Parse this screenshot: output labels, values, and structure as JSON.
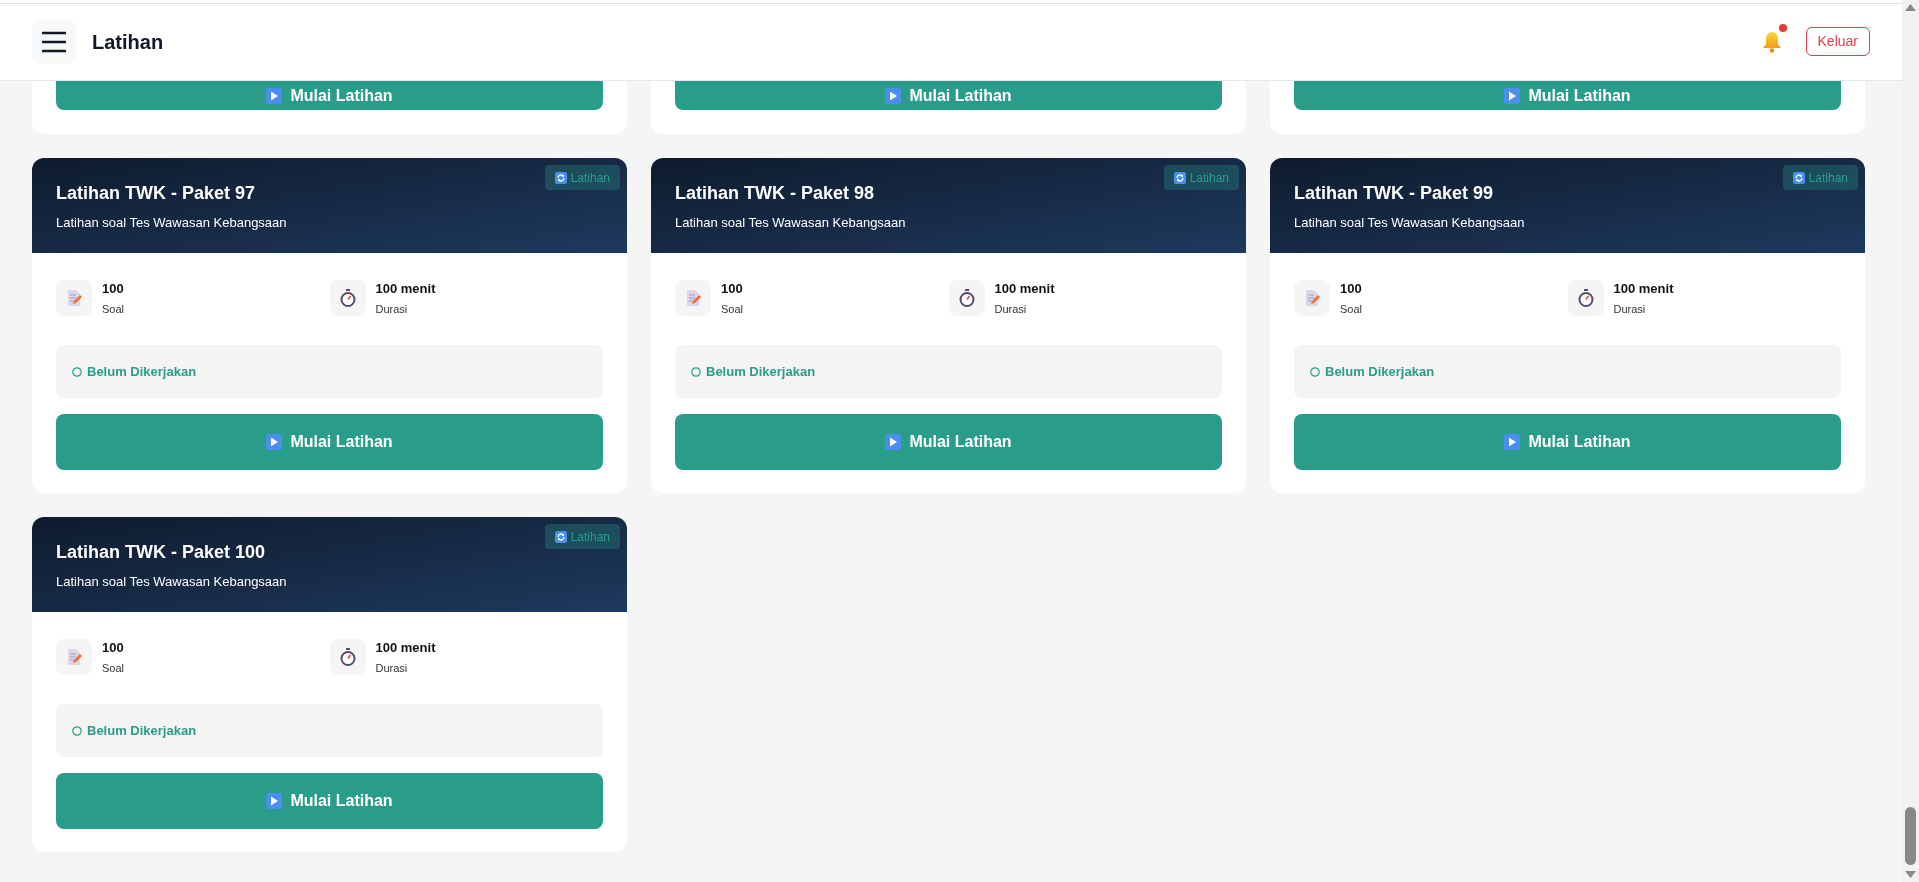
{
  "header": {
    "title": "Latihan",
    "logout": "Keluar",
    "notification": true
  },
  "cards": [
    {
      "kind": "partial",
      "button": "Mulai Latihan"
    },
    {
      "kind": "partial",
      "button": "Mulai Latihan"
    },
    {
      "kind": "partial",
      "button": "Mulai Latihan"
    },
    {
      "kind": "full",
      "title": "Latihan TWK - Paket 97",
      "subtitle": "Latihan soal Tes Wawasan Kebangsaan",
      "badge": "Latihan",
      "stats": [
        {
          "value": "100",
          "label": "Soal"
        },
        {
          "value": "100 menit",
          "label": "Durasi"
        }
      ],
      "status": "Belum Dikerjakan",
      "button": "Mulai Latihan"
    },
    {
      "kind": "full",
      "title": "Latihan TWK - Paket 98",
      "subtitle": "Latihan soal Tes Wawasan Kebangsaan",
      "badge": "Latihan",
      "stats": [
        {
          "value": "100",
          "label": "Soal"
        },
        {
          "value": "100 menit",
          "label": "Durasi"
        }
      ],
      "status": "Belum Dikerjakan",
      "button": "Mulai Latihan"
    },
    {
      "kind": "full",
      "title": "Latihan TWK - Paket 99",
      "subtitle": "Latihan soal Tes Wawasan Kebangsaan",
      "badge": "Latihan",
      "stats": [
        {
          "value": "100",
          "label": "Soal"
        },
        {
          "value": "100 menit",
          "label": "Durasi"
        }
      ],
      "status": "Belum Dikerjakan",
      "button": "Mulai Latihan"
    },
    {
      "kind": "full",
      "title": "Latihan TWK - Paket 100",
      "subtitle": "Latihan soal Tes Wawasan Kebangsaan",
      "badge": "Latihan",
      "stats": [
        {
          "value": "100",
          "label": "Soal"
        },
        {
          "value": "100 menit",
          "label": "Durasi"
        }
      ],
      "status": "Belum Dikerjakan",
      "button": "Mulai Latihan"
    }
  ]
}
